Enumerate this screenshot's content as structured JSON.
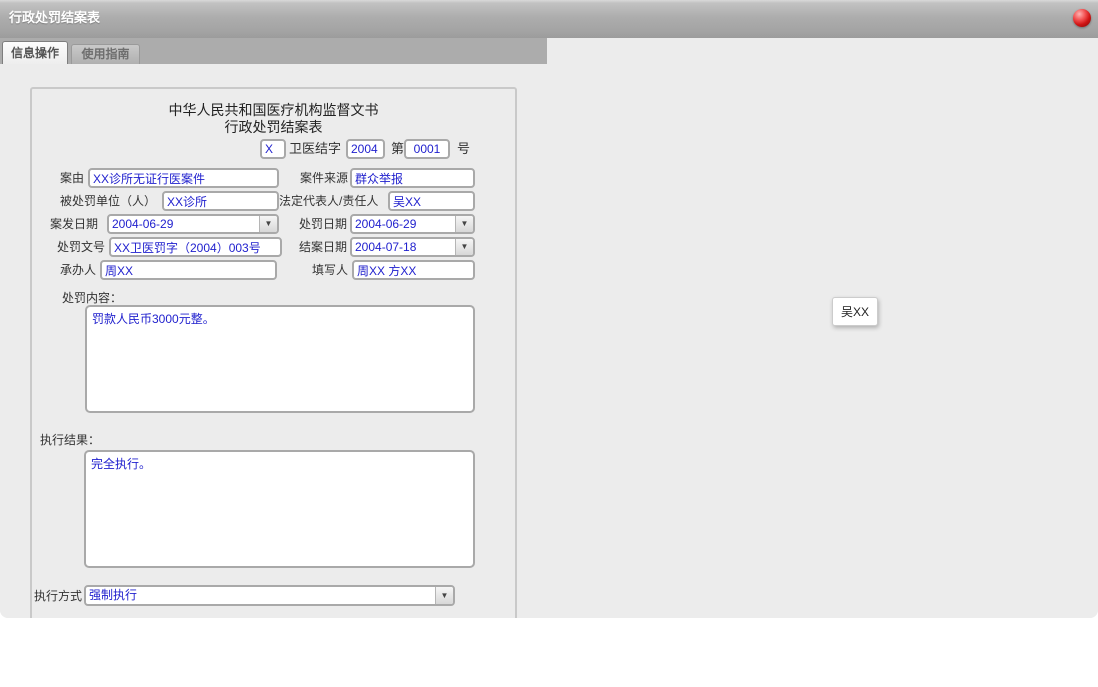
{
  "window": {
    "title": "行政处罚结案表"
  },
  "tabs": [
    {
      "label": "信息操作",
      "active": true
    },
    {
      "label": "使用指南",
      "active": false
    }
  ],
  "icons": {
    "dropdown_arrow": "▼",
    "red_ball": "red-sphere"
  },
  "colors": {
    "titlebar_gray": "#a8a8a8",
    "tabstrip_gray": "#acacac",
    "content_bg": "#ececec",
    "input_border": "#a9a9a9",
    "value_blue": "#2121ce",
    "label_dark": "#333333",
    "ball_red": "#d01515"
  },
  "form": {
    "header_line1": "中华人民共和国医疗机构监督文书",
    "header_line2": "行政处罚结案表",
    "doc_number": {
      "prefix_value": "X",
      "label_middle": "卫医结字",
      "year_value": "2004",
      "label_di": "第",
      "serial_value": "0001",
      "label_hao": "号"
    },
    "fields": {
      "case_cause": {
        "label": "案由",
        "value": "XX诊所无证行医案件"
      },
      "case_source": {
        "label": "案件来源",
        "value": "群众举报"
      },
      "punished_unit": {
        "label": "被处罚单位（人）",
        "value": "XX诊所"
      },
      "legal_rep": {
        "label": "法定代表人/责任人",
        "value": "吴XX"
      },
      "case_date": {
        "label": "案发日期",
        "value": "2004-06-29"
      },
      "penalty_date": {
        "label": "处罚日期",
        "value": "2004-06-29"
      },
      "penalty_doc_no": {
        "label": "处罚文号",
        "value": "XX卫医罚字（2004）003号"
      },
      "close_date": {
        "label": "结案日期",
        "value": "2004-07-18"
      },
      "handler": {
        "label": "承办人",
        "value": "周XX"
      },
      "filler": {
        "label": "填写人",
        "value": "周XX 方XX"
      },
      "penalty_content": {
        "label": "处罚内容：",
        "value": "罚款人民币3000元整。"
      },
      "exec_result": {
        "label": "执行结果：",
        "value": "完全执行。"
      },
      "exec_method": {
        "label": "执行方式：",
        "value": "强制执行"
      }
    }
  },
  "tooltip": {
    "text": "吴XX"
  }
}
